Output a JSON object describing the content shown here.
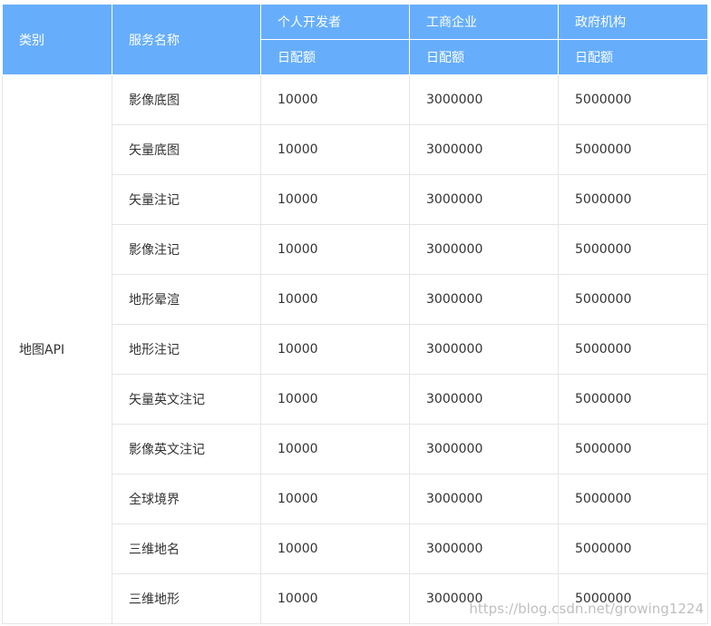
{
  "headers": {
    "category": "类别",
    "service_name": "服务名称",
    "individual": "个人开发者",
    "enterprise": "工商企业",
    "government": "政府机构",
    "daily_quota": "日配额"
  },
  "category_value": "地图API",
  "rows": [
    {
      "service": "影像底图",
      "individual": "10000",
      "enterprise": "3000000",
      "government": "5000000"
    },
    {
      "service": "矢量底图",
      "individual": "10000",
      "enterprise": "3000000",
      "government": "5000000"
    },
    {
      "service": "矢量注记",
      "individual": "10000",
      "enterprise": "3000000",
      "government": "5000000"
    },
    {
      "service": "影像注记",
      "individual": "10000",
      "enterprise": "3000000",
      "government": "5000000"
    },
    {
      "service": "地形晕渲",
      "individual": "10000",
      "enterprise": "3000000",
      "government": "5000000"
    },
    {
      "service": "地形注记",
      "individual": "10000",
      "enterprise": "3000000",
      "government": "5000000"
    },
    {
      "service": "矢量英文注记",
      "individual": "10000",
      "enterprise": "3000000",
      "government": "5000000"
    },
    {
      "service": "影像英文注记",
      "individual": "10000",
      "enterprise": "3000000",
      "government": "5000000"
    },
    {
      "service": "全球境界",
      "individual": "10000",
      "enterprise": "3000000",
      "government": "5000000"
    },
    {
      "service": "三维地名",
      "individual": "10000",
      "enterprise": "3000000",
      "government": "5000000"
    },
    {
      "service": "三维地形",
      "individual": "10000",
      "enterprise": "3000000",
      "government": "5000000"
    }
  ],
  "watermark": "https://blog.csdn.net/growing1224",
  "colors": {
    "header_bg": "#66aefc",
    "header_text": "#ffffff",
    "border": "#e5e5e5",
    "cell_text": "#333333"
  }
}
